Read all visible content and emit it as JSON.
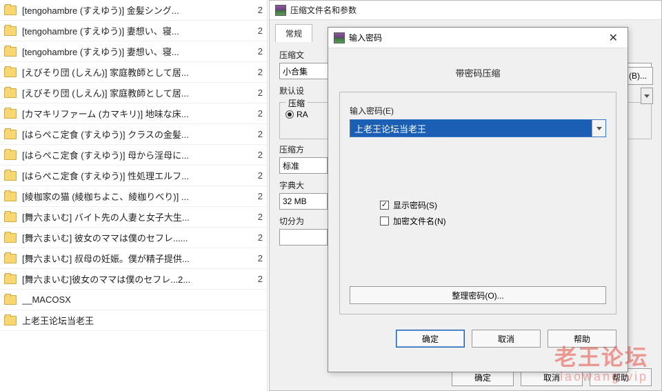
{
  "file_list": [
    {
      "name": "[tengohambre (すえゆう)] 金髪シング...",
      "col2": "2"
    },
    {
      "name": "[tengohambre (すえゆう)] 妻想い、寝...",
      "col2": "2"
    },
    {
      "name": "[tengohambre (すえゆう)] 妻想い、寝...",
      "col2": "2"
    },
    {
      "name": "[えびそり団 (しえん)] 家庭教師として居...",
      "col2": "2"
    },
    {
      "name": "[えびそり団 (しえん)] 家庭教師として居...",
      "col2": "2"
    },
    {
      "name": "[カマキリファーム (カマキリ)] 地味な床...",
      "col2": "2"
    },
    {
      "name": "[はらぺこ定食 (すえゆう)] クラスの金髪...",
      "col2": "2"
    },
    {
      "name": "[はらぺこ定食 (すえゆう)] 母から淫母に...",
      "col2": "2"
    },
    {
      "name": "[はらぺこ定食 (すえゆう)] 性処理エルフ...",
      "col2": "2"
    },
    {
      "name": "[綾枷家の猫 (綾枷ちよこ、綾枷りべり)] ...",
      "col2": "2"
    },
    {
      "name": "[舞六まいむ] バイト先の人妻と女子大生...",
      "col2": "2"
    },
    {
      "name": "[舞六まいむ] 彼女のママは僕のセフレ......",
      "col2": "2"
    },
    {
      "name": "[舞六まいむ] 叔母の妊娠。僕が精子提供...",
      "col2": "2"
    },
    {
      "name": "[舞六まいむ]彼女のママは僕のセフレ...2...",
      "col2": "2"
    },
    {
      "name": "__MACOSX",
      "col2": ""
    },
    {
      "name": "上老王论坛当老王",
      "col2": ""
    }
  ],
  "archive_dialog": {
    "title": "压缩文件名和参数",
    "tab_general": "常规",
    "label_name": "压缩文",
    "value_name": "小合集",
    "label_default": "默认设",
    "group_format": "压缩",
    "radio_rar": "RA",
    "label_method": "压缩方",
    "value_method": "标准",
    "label_dict": "字典大",
    "value_dict": "32 MB",
    "label_split": "切分为",
    "btn_browse": "(B)...",
    "btn_ok": "确定",
    "btn_cancel": "取消",
    "btn_help": "帮助"
  },
  "pwd_dialog": {
    "title": "输入密码",
    "section": "带密码压缩",
    "label_input": "输入密码(E)",
    "password_value": "上老王论坛当老王",
    "chk_show": "显示密码(S)",
    "chk_encrypt": "加密文件名(N)",
    "btn_organize": "整理密码(O)...",
    "btn_ok": "确定",
    "btn_cancel": "取消",
    "btn_help": "帮助"
  },
  "watermark": {
    "main": "老王论坛",
    "sub": "laowang.vip"
  }
}
